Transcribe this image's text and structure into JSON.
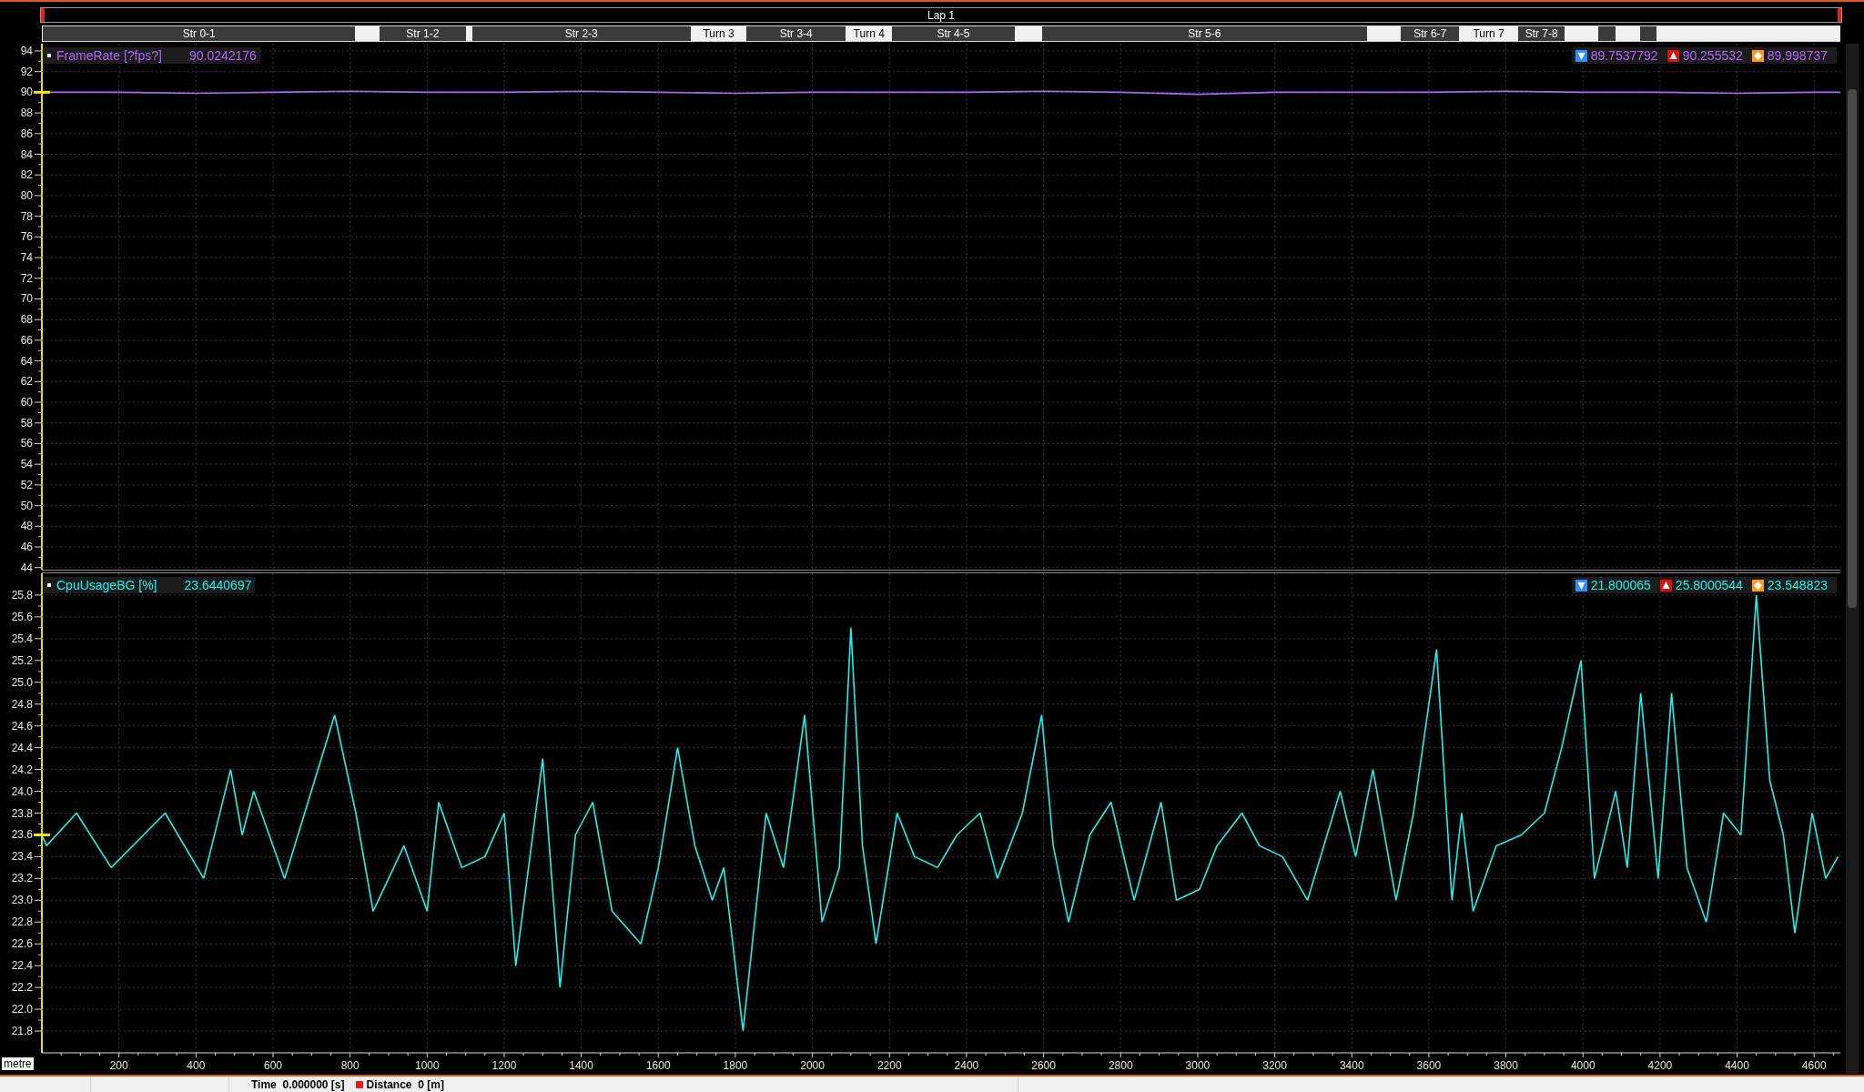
{
  "lap_bar": {
    "label": "Lap 1"
  },
  "segments": [
    {
      "label": "Str 0-1",
      "kind": "straight"
    },
    {
      "kind": "turn"
    },
    {
      "label": "Str 1-2",
      "kind": "straight"
    },
    {
      "kind": "turn"
    },
    {
      "label": "Str 2-3",
      "kind": "straight"
    },
    {
      "label": "Turn 3",
      "kind": "turn"
    },
    {
      "label": "Str 3-4",
      "kind": "straight"
    },
    {
      "label": "Turn 4",
      "kind": "turn"
    },
    {
      "label": "Str 4-5",
      "kind": "straight"
    },
    {
      "kind": "turn"
    },
    {
      "label": "Str 5-6",
      "kind": "straight"
    },
    {
      "kind": "turn"
    },
    {
      "label": "Str 6-7",
      "kind": "straight"
    },
    {
      "label": "Turn 7",
      "kind": "turn"
    },
    {
      "label": "Str 7-8",
      "kind": "straight"
    },
    {
      "kind": "turn"
    },
    {
      "kind": "straight"
    },
    {
      "kind": "turn"
    },
    {
      "kind": "straight"
    },
    {
      "kind": "turn"
    }
  ],
  "panes": [
    {
      "legend": {
        "value": "90.0242176",
        "min": "89.7537792",
        "max": "90.255532",
        "avg": "89.998737"
      },
      "chart_data": {
        "type": "line",
        "grid": true,
        "xlim": [
          0,
          4668
        ],
        "ylim": [
          43.8,
          94.7
        ],
        "yticks": [
          44,
          46,
          48,
          50,
          52,
          54,
          56,
          58,
          60,
          62,
          64,
          66,
          68,
          70,
          72,
          74,
          76,
          78,
          80,
          82,
          84,
          86,
          88,
          90,
          92,
          94
        ],
        "x": [
          0,
          200,
          400,
          600,
          800,
          1000,
          1200,
          1400,
          1600,
          1800,
          2000,
          2200,
          2400,
          2600,
          2800,
          3000,
          3200,
          3400,
          3600,
          3800,
          4000,
          4200,
          4400,
          4600,
          4668
        ],
        "series": [
          {
            "name": "FrameRate [?fps?]",
            "color": "#b266ff",
            "values": [
              90.0,
              90.0,
              89.9,
              90.0,
              90.1,
              90.0,
              90.0,
              90.1,
              90.0,
              89.9,
              90.0,
              90.0,
              90.0,
              90.1,
              90.0,
              89.8,
              90.0,
              90.0,
              90.0,
              90.1,
              90.0,
              90.0,
              89.9,
              90.0,
              90.0
            ]
          }
        ]
      }
    },
    {
      "legend": {
        "value": "23.6440697",
        "min": "21.800065",
        "max": "25.8000544",
        "avg": "23.548823"
      },
      "chart_data": {
        "type": "line",
        "grid": true,
        "xlim": [
          0,
          4668
        ],
        "ylim": [
          21.6,
          26.0
        ],
        "xlabel": "metre",
        "yticks": [
          {
            "value": 21.8,
            "label": "21.8"
          },
          {
            "value": 22,
            "label": "22.0"
          },
          {
            "value": 22.2,
            "label": "22.2"
          },
          {
            "value": 22.4,
            "label": "22.4"
          },
          {
            "value": 22.6,
            "label": "22.6"
          },
          {
            "value": 22.8,
            "label": "22.8"
          },
          {
            "value": 23,
            "label": "23.0"
          },
          {
            "value": 23.2,
            "label": "23.2"
          },
          {
            "value": 23.4,
            "label": "23.4"
          },
          {
            "value": 23.6,
            "label": "23.6"
          },
          {
            "value": 23.8,
            "label": "23.8"
          },
          {
            "value": 24,
            "label": "24.0"
          },
          {
            "value": 24.2,
            "label": "24.2"
          },
          {
            "value": 24.4,
            "label": "24.4"
          },
          {
            "value": 24.6,
            "label": "24.6"
          },
          {
            "value": 24.8,
            "label": "24.8"
          },
          {
            "value": 25,
            "label": "25.0"
          },
          {
            "value": 25.2,
            "label": "25.2"
          },
          {
            "value": 25.4,
            "label": "25.4"
          },
          {
            "value": 25.6,
            "label": "25.6"
          },
          {
            "value": 25.8,
            "label": "25.8"
          }
        ],
        "xticks": [
          200,
          400,
          600,
          800,
          1000,
          1200,
          1400,
          1600,
          1800,
          2000,
          2200,
          2400,
          2600,
          2800,
          3000,
          3200,
          3400,
          3600,
          3800,
          4000,
          4200,
          4400,
          4600
        ],
        "x": [
          0,
          12,
          90,
          180,
          320,
          420,
          490,
          520,
          550,
          630,
          760,
          815,
          860,
          940,
          1000,
          1030,
          1090,
          1150,
          1200,
          1230,
          1300,
          1345,
          1385,
          1430,
          1480,
          1555,
          1600,
          1650,
          1695,
          1740,
          1770,
          1820,
          1880,
          1925,
          1980,
          2025,
          2070,
          2100,
          2130,
          2165,
          2220,
          2265,
          2325,
          2375,
          2435,
          2480,
          2545,
          2595,
          2625,
          2665,
          2720,
          2775,
          2835,
          2905,
          2945,
          3005,
          3050,
          3115,
          3160,
          3220,
          3285,
          3370,
          3410,
          3455,
          3515,
          3560,
          3620,
          3660,
          3685,
          3715,
          3775,
          3840,
          3900,
          3945,
          3995,
          4030,
          4085,
          4115,
          4150,
          4195,
          4230,
          4270,
          4320,
          4365,
          4410,
          4450,
          4485,
          4520,
          4550,
          4595,
          4630,
          4662
        ],
        "series": [
          {
            "name": "CpuUsageBG [%]",
            "color": "#19f5f0",
            "values": [
              23.6,
              23.5,
              23.8,
              23.3,
              23.8,
              23.2,
              24.2,
              23.6,
              24.0,
              23.2,
              24.7,
              23.8,
              22.9,
              23.5,
              22.9,
              23.9,
              23.3,
              23.4,
              23.8,
              22.4,
              24.3,
              22.2,
              23.6,
              23.9,
              22.9,
              22.6,
              23.3,
              24.4,
              23.5,
              23.0,
              23.3,
              21.8,
              23.8,
              23.3,
              24.7,
              22.8,
              23.3,
              25.5,
              23.5,
              22.6,
              23.8,
              23.4,
              23.3,
              23.6,
              23.8,
              23.2,
              23.8,
              24.7,
              23.5,
              22.8,
              23.6,
              23.9,
              23.0,
              23.9,
              23.0,
              23.1,
              23.5,
              23.8,
              23.5,
              23.4,
              23.0,
              24.0,
              23.4,
              24.2,
              23.0,
              23.8,
              25.3,
              23.0,
              23.8,
              22.9,
              23.5,
              23.6,
              23.8,
              24.4,
              25.2,
              23.2,
              24.0,
              23.3,
              24.9,
              23.2,
              24.9,
              23.3,
              22.8,
              23.8,
              23.6,
              25.8,
              24.1,
              23.6,
              22.7,
              23.8,
              23.2,
              23.4
            ]
          }
        ]
      }
    }
  ],
  "status_bar": {
    "time": "Time  0.000000 [s]",
    "distance": "Distance  0 [m]"
  }
}
